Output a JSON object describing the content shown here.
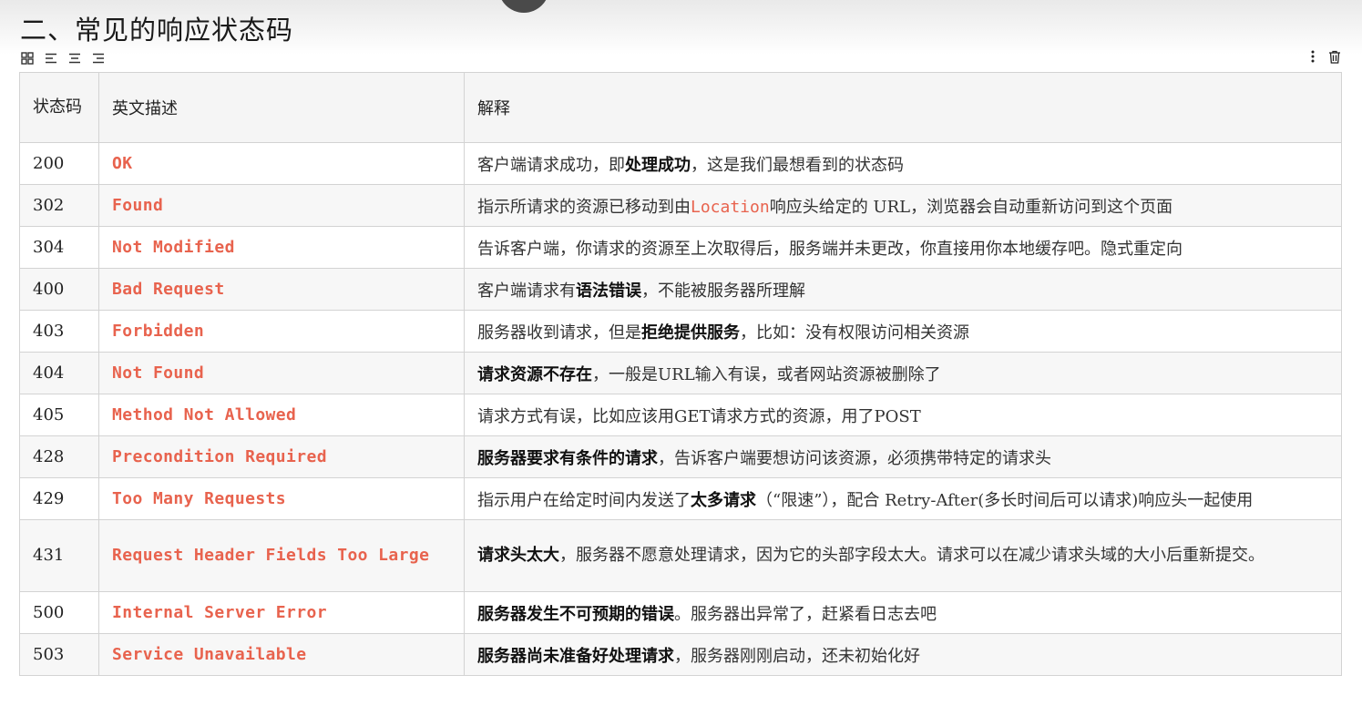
{
  "title": "二、常见的响应状态码",
  "toolbar": {
    "icons": [
      "grid-icon",
      "align-left-icon",
      "align-center-icon",
      "align-right-icon"
    ],
    "right_icons": [
      "more-vertical-icon",
      "trash-icon"
    ]
  },
  "table": {
    "headers": [
      "状态码",
      "英文描述",
      "解释"
    ],
    "rows": [
      {
        "code": "200",
        "name": "OK",
        "desc": [
          {
            "t": "客户端请求成功，即"
          },
          {
            "t": "处理成功",
            "b": true
          },
          {
            "t": "，这是我们最想看到的状态码"
          }
        ]
      },
      {
        "code": "302",
        "name": "Found",
        "desc": [
          {
            "t": "指示所请求的资源已移动到由"
          },
          {
            "t": "Location",
            "c": true
          },
          {
            "t": "响应头给定的 URL，浏览器会自动重新访问到这个页面"
          }
        ]
      },
      {
        "code": "304",
        "name": "Not Modified",
        "desc": [
          {
            "t": "告诉客户端，你请求的资源至上次取得后，服务端并未更改，你直接用你本地缓存吧。隐式重定向"
          }
        ]
      },
      {
        "code": "400",
        "name": "Bad Request",
        "desc": [
          {
            "t": "客户端请求有"
          },
          {
            "t": "语法错误",
            "b": true
          },
          {
            "t": "，不能被服务器所理解"
          }
        ]
      },
      {
        "code": "403",
        "name": "Forbidden",
        "desc": [
          {
            "t": "服务器收到请求，但是"
          },
          {
            "t": "拒绝提供服务",
            "b": true
          },
          {
            "t": "，比如：没有权限访问相关资源"
          }
        ]
      },
      {
        "code": "404",
        "name": "Not Found",
        "desc": [
          {
            "t": "请求资源不存在",
            "b": true
          },
          {
            "t": "，一般是URL输入有误，或者网站资源被删除了"
          }
        ]
      },
      {
        "code": "405",
        "name": "Method Not Allowed",
        "desc": [
          {
            "t": "请求方式有误，比如应该用GET请求方式的资源，用了POST"
          }
        ]
      },
      {
        "code": "428",
        "name": "Precondition Required",
        "desc": [
          {
            "t": "服务器要求有条件的请求",
            "b": true
          },
          {
            "t": "，告诉客户端要想访问该资源，必须携带特定的请求头"
          }
        ]
      },
      {
        "code": "429",
        "name": "Too Many Requests",
        "desc": [
          {
            "t": "指示用户在给定时间内发送了"
          },
          {
            "t": "太多请求",
            "b": true
          },
          {
            "t": "（“限速”），配合 Retry-After(多长时间后可以请求)响应头一起使用"
          }
        ]
      },
      {
        "code": "431",
        "name": "Request Header Fields Too Large",
        "desc": [
          {
            "t": "请求头太大",
            "b": true
          },
          {
            "t": "，服务器不愿意处理请求，因为它的头部字段太大。请求可以在减少请求头域的大小后重新提交。"
          }
        ]
      },
      {
        "code": "500",
        "name": "Internal Server Error",
        "desc": [
          {
            "t": "服务器发生不可预期的错误",
            "b": true
          },
          {
            "t": "。服务器出异常了，赶紧看日志去吧"
          }
        ]
      },
      {
        "code": "503",
        "name": "Service Unavailable",
        "desc": [
          {
            "t": "服务器尚未准备好处理请求",
            "b": true
          },
          {
            "t": "，服务器刚刚启动，还未初始化好"
          }
        ]
      }
    ]
  }
}
